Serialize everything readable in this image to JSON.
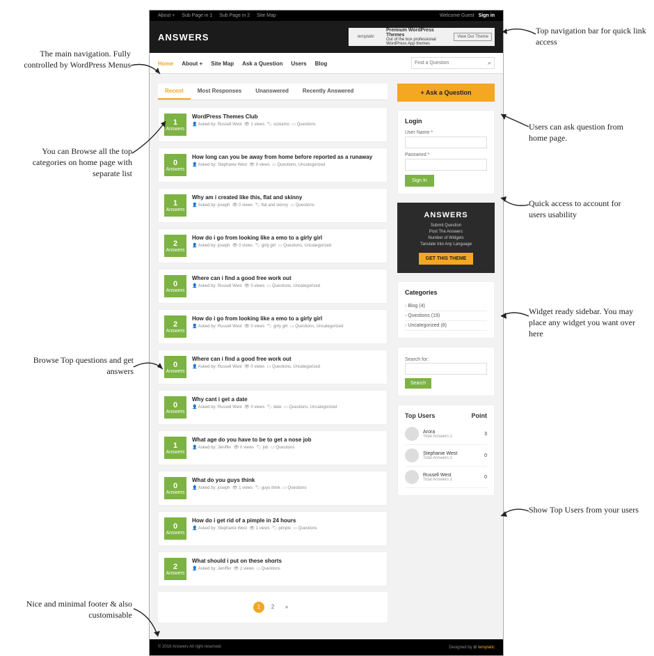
{
  "topbar": {
    "about": "About +",
    "sp1": "Sub Page in 1",
    "sp2": "Sub Page in 2",
    "sitemap": "Site Map",
    "welcome": "Welcome Guest",
    "signin": "Sign in"
  },
  "logo": "ANSWERS",
  "ad": {
    "tlogo": "templatic",
    "title": "Premium WordPress Themes",
    "sub": "Out of the box professional WordPress App themes",
    "btn": "View Our Theme",
    "url": "www.templatic.com"
  },
  "nav": [
    "Home",
    "About +",
    "Site Map",
    "Ask a Question",
    "Users",
    "Blog"
  ],
  "search": {
    "placeholder": "Find a Question"
  },
  "tabs": [
    "Recent",
    "Most Responses",
    "Unanswered",
    "Recently Answered"
  ],
  "questions": [
    {
      "n": 1,
      "title": "WordPress Themes Club",
      "by": "Russell West",
      "views": "1 views",
      "tags": "screamo",
      "cats": "Questions"
    },
    {
      "n": 0,
      "title": "How long can you be away from home before reported as a runaway",
      "by": "Stephanie West",
      "views": "0 views",
      "tags": "",
      "cats": "Questions, Uncategorized"
    },
    {
      "n": 1,
      "title": "Why am i created like this, flat and skinny",
      "by": "joseph",
      "views": "0 views",
      "tags": "flat and skinny",
      "cats": "Questions"
    },
    {
      "n": 2,
      "title": "How do i go from looking like a emo to a girly girl",
      "by": "joseph",
      "views": "0 views",
      "tags": "girly girl",
      "cats": "Questions, Uncategorized"
    },
    {
      "n": 0,
      "title": "Where can i find a good free work out",
      "by": "Russell West",
      "views": "0 views",
      "tags": "",
      "cats": "Questions, Uncategorized"
    },
    {
      "n": 2,
      "title": "How do i go from looking like a emo to a girly girl",
      "by": "Russell West",
      "views": "0 views",
      "tags": "girly girl",
      "cats": "Questions, Uncategorized"
    },
    {
      "n": 0,
      "title": "Where can i find a good free work out",
      "by": "Russell West",
      "views": "0 views",
      "tags": "",
      "cats": "Questions, Uncategorized"
    },
    {
      "n": 0,
      "title": "Why cant i get a date",
      "by": "Russell West",
      "views": "0 views",
      "tags": "date",
      "cats": "Questions, Uncategorized"
    },
    {
      "n": 1,
      "title": "What age do you have to be to get a nose job",
      "by": "Jeniffer",
      "views": "0 views",
      "tags": "job",
      "cats": "Questions"
    },
    {
      "n": 0,
      "title": "What do you guys think",
      "by": "joseph",
      "views": "1 views",
      "tags": "guys think",
      "cats": "Questions"
    },
    {
      "n": 0,
      "title": "How do i get rid of a pimple in 24 hours",
      "by": "Stephanie West",
      "views": "1 views",
      "tags": "pimple",
      "cats": "Questions"
    },
    {
      "n": 2,
      "title": "What should i put on these shorts",
      "by": "Jeniffer",
      "views": "2 views",
      "tags": "",
      "cats": "Questions"
    }
  ],
  "answers_label": "Answers",
  "meta_labels": {
    "by": "Asked by:",
    "views": "",
    "tags": "",
    "cats": ""
  },
  "pagination": [
    "1",
    "2",
    "»"
  ],
  "ask_btn": "+ Ask a Question",
  "login": {
    "title": "Login",
    "user": "User Name *",
    "pass": "Password *",
    "btn": "Sign In"
  },
  "promo": {
    "logo": "ANSWERS",
    "l1": "Submit Question",
    "l2": "Post The Answers",
    "l3": "Number of Widgets",
    "l4": "Tanslate Into Any Language",
    "btn": "GET THIS THEME"
  },
  "categories": {
    "title": "Categories",
    "items": [
      "Blog (4)",
      "Questions (19)",
      "Uncategorized (8)"
    ]
  },
  "searchfor": {
    "label": "Search for:",
    "btn": "Search"
  },
  "topusers": {
    "title": "Top Users",
    "pts": "Point",
    "users": [
      {
        "name": "Arora",
        "sub": "Total Answers:1",
        "pts": "3"
      },
      {
        "name": "Stephanie West",
        "sub": "Total Answers:1",
        "pts": "0"
      },
      {
        "name": "Russell West",
        "sub": "Total Answers:1",
        "pts": "0"
      }
    ]
  },
  "footer": {
    "left": "© 2016 Answers All right reserved.",
    "right": "Designed by",
    "brand": "templatic"
  },
  "annotations": {
    "a1": "Top navigation bar for quick link access",
    "a2": "The main navigation. Fully controlled by WordPress Menus",
    "a3": "You can Browse all the top categories on home page with separate list",
    "a4": "Users can ask question from home page.",
    "a5": "Quick access to account for users usability",
    "a6": "Widget ready sidebar. You may place any widget you want over here",
    "a7": "Browse Top questions and get answers",
    "a8": "Show Top Users from your users",
    "a9": "Nice and minimal footer & also customisable"
  }
}
